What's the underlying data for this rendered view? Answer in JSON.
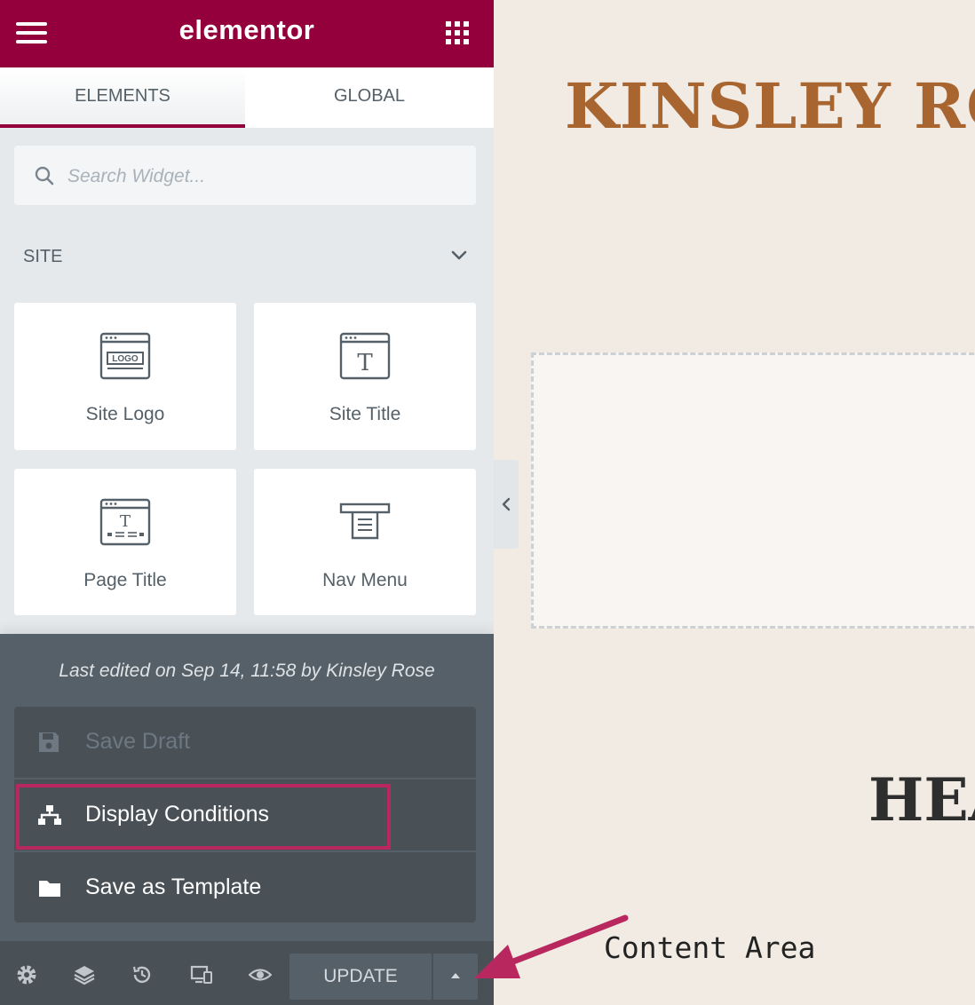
{
  "colors": {
    "brand": "#93003c",
    "panel_bg": "#e6e9ec",
    "footer_bg": "#556068",
    "menu_bg": "#495157",
    "site_title": "#a9652f",
    "highlight": "#b8285e",
    "annotation_arrow": "#b8285e"
  },
  "header": {
    "brand": "elementor",
    "menu_icon": "hamburger-icon",
    "apps_icon": "grid-icon"
  },
  "tabs": [
    {
      "label": "ELEMENTS",
      "active": true
    },
    {
      "label": "GLOBAL",
      "active": false
    }
  ],
  "search": {
    "placeholder": "Search Widget...",
    "value": ""
  },
  "category": {
    "label": "SITE",
    "expanded": true
  },
  "widgets": [
    {
      "label": "Site Logo",
      "icon": "site-logo-icon",
      "icon_text": "LOGO"
    },
    {
      "label": "Site Title",
      "icon": "site-title-icon",
      "icon_text": "T"
    },
    {
      "label": "Page Title",
      "icon": "page-title-icon",
      "icon_text": "T"
    },
    {
      "label": "Nav Menu",
      "icon": "nav-menu-icon"
    }
  ],
  "footer": {
    "last_edited": "Last edited on Sep 14, 11:58 by Kinsley Rose",
    "menu": [
      {
        "label": "Save Draft",
        "icon": "floppy-disk-icon",
        "disabled": true
      },
      {
        "label": "Display Conditions",
        "icon": "sitemap-icon",
        "highlighted": true
      },
      {
        "label": "Save as Template",
        "icon": "folder-icon"
      }
    ]
  },
  "bottom_bar": {
    "icons": [
      "settings-icon",
      "layers-icon",
      "history-icon",
      "responsive-icon",
      "preview-icon"
    ],
    "update_label": "UPDATE"
  },
  "canvas": {
    "site_title": "KINSLEY ROS",
    "heading_partial": "HEA",
    "annotation": "Content Area"
  }
}
